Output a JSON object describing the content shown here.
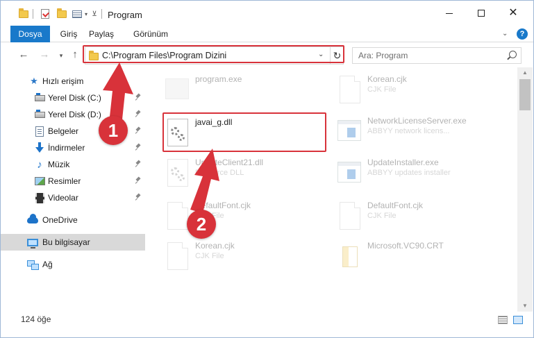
{
  "window": {
    "title": "Program"
  },
  "ribbon": {
    "tabs": [
      "Dosya",
      "Giriş",
      "Paylaş",
      "Görünüm"
    ]
  },
  "address": {
    "path": "C:\\Program Files\\Program Dizini"
  },
  "search": {
    "placeholder": "Ara: Program"
  },
  "sidebar": {
    "quick_access": "Hızlı erişim",
    "items": [
      {
        "label": "Yerel Disk (C:)",
        "icon": "drive-icon"
      },
      {
        "label": "Yerel Disk (D:)",
        "icon": "drive-icon"
      },
      {
        "label": "Belgeler",
        "icon": "documents-icon"
      },
      {
        "label": "İndirmeler",
        "icon": "downloads-icon"
      },
      {
        "label": "Müzik",
        "icon": "music-icon"
      },
      {
        "label": "Resimler",
        "icon": "pictures-icon"
      },
      {
        "label": "Videolar",
        "icon": "videos-icon"
      }
    ],
    "onedrive": "OneDrive",
    "this_pc": "Bu bilgisayar",
    "network": "Ağ"
  },
  "files": {
    "left": [
      {
        "name": "program.exe",
        "desc": ""
      },
      {
        "name": "javai_g.dll",
        "desc": ""
      },
      {
        "name": "UpdateClient21.dll",
        "desc": "Resource DLL"
      },
      {
        "name": "DefaultFont.cjk",
        "desc": "CJK File"
      },
      {
        "name": "Korean.cjk",
        "desc": "CJK File"
      }
    ],
    "right": [
      {
        "name": "Korean.cjk",
        "desc": "CJK File"
      },
      {
        "name": "NetworkLicenseServer.exe",
        "desc": "ABBYY network licens..."
      },
      {
        "name": "UpdateInstaller.exe",
        "desc": "ABBYY updates installer"
      },
      {
        "name": "DefaultFont.cjk",
        "desc": "CJK File"
      },
      {
        "name": "Microsoft.VC90.CRT",
        "desc": ""
      }
    ]
  },
  "status": {
    "count": "124 öğe"
  },
  "annotations": {
    "step1": "1",
    "step2": "2",
    "color": "#d8323a"
  },
  "colors": {
    "accent": "#1979ca",
    "selection": "#d9d9d9"
  }
}
